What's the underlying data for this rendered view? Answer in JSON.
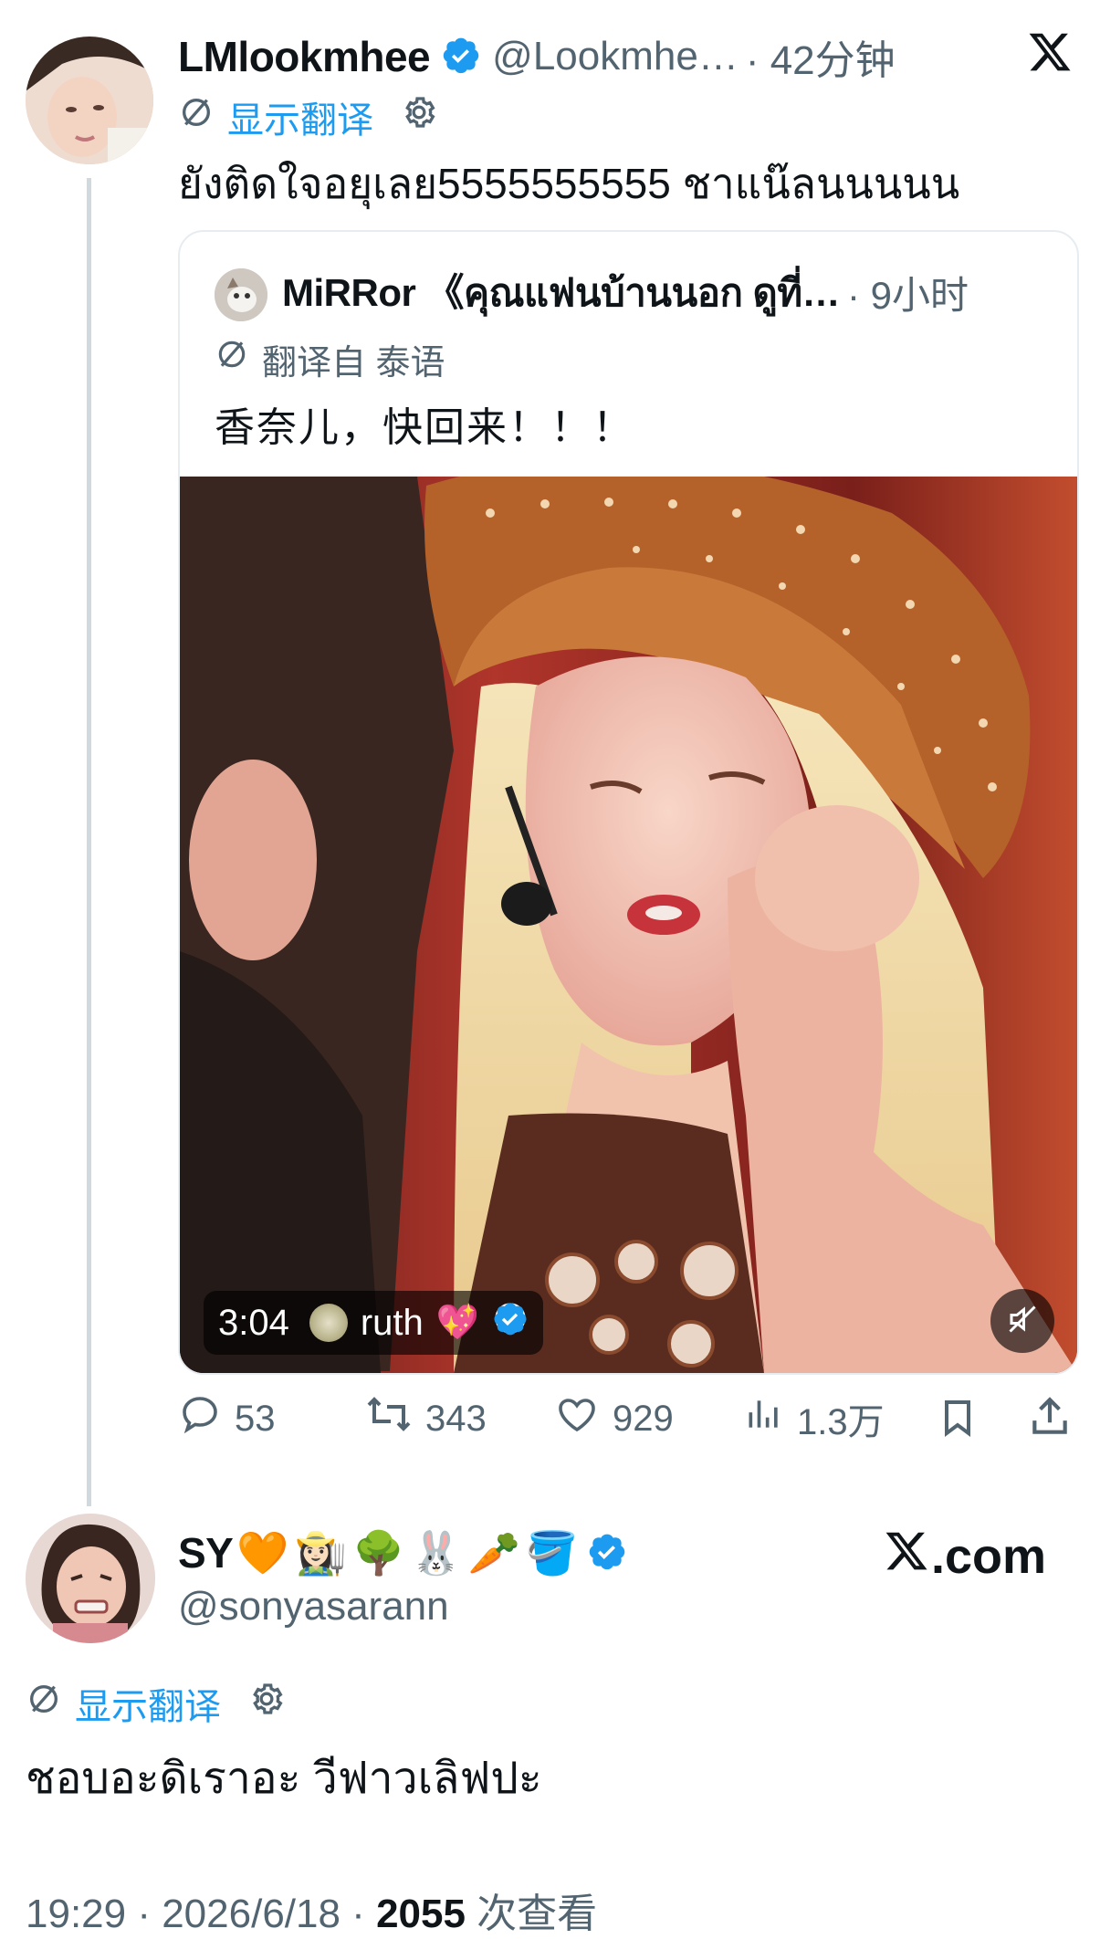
{
  "post": {
    "author_name": "LMlookmhee",
    "author_handle": "@Lookmhe…",
    "time_ago": "· 42分钟",
    "translate_label": "显示翻译",
    "text": "ยังติดใจอยุเลย5555555555 ชาแน๊ลนนนนน"
  },
  "quote": {
    "author_name": "MiRRor 《คุณแฟนบ้านนอก ดูที่…",
    "time_ago": "· 9小时",
    "translated_from": "翻译自 泰语",
    "text": "香奈儿，快回来！！！",
    "video": {
      "duration": "3:04",
      "overlay_user": "ruth",
      "overlay_emoji": "💖"
    }
  },
  "actions": {
    "replies": "53",
    "reposts": "343",
    "likes": "929",
    "views": "1.3万"
  },
  "reply": {
    "author_name": "SY",
    "author_emojis": [
      "🧡",
      "👩🏻‍🌾",
      "🌳",
      "🐰",
      "🥕",
      "🪣"
    ],
    "author_handle": "@sonyasarann",
    "translate_label": "显示翻译",
    "text": "ชอบอะดิเราอะ วีฟาวเลิฟปะ",
    "timestamp": "19:29 · 2026/6/18 · ",
    "view_count": "2055",
    "view_label": " 次查看"
  },
  "watermark": "X.com",
  "colors": {
    "accent": "#1d9bf0",
    "muted": "#536471",
    "border": "#e6ecf0",
    "verified": "#1d9bf0"
  }
}
